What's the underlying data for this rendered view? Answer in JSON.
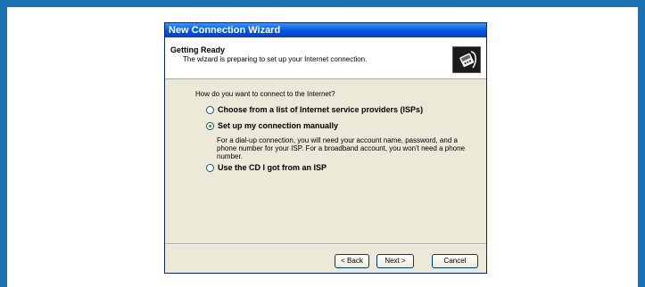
{
  "window": {
    "title": "New Connection Wizard"
  },
  "header": {
    "title": "Getting Ready",
    "subtitle": "The wizard is preparing to set up your Internet connection.",
    "icon": "network-connection-icon"
  },
  "content": {
    "question": "How do you want to connect to the Internet?",
    "options": [
      {
        "label": "Choose from a list of Internet service providers (ISPs)",
        "selected": false
      },
      {
        "label": "Set up my connection manually",
        "selected": true
      },
      {
        "label": "Use the CD I got from an ISP",
        "selected": false
      }
    ],
    "manual_description": "For a dial-up connection, you will need your account name, password, and a phone number for your ISP. For a broadband account, you won't need a phone number."
  },
  "buttons": {
    "back": "< Back",
    "next": "Next >",
    "cancel": "Cancel"
  },
  "colors": {
    "frame": "#1a72b5",
    "titlebar": "#0054e3",
    "dialog": "#ece9d8"
  }
}
